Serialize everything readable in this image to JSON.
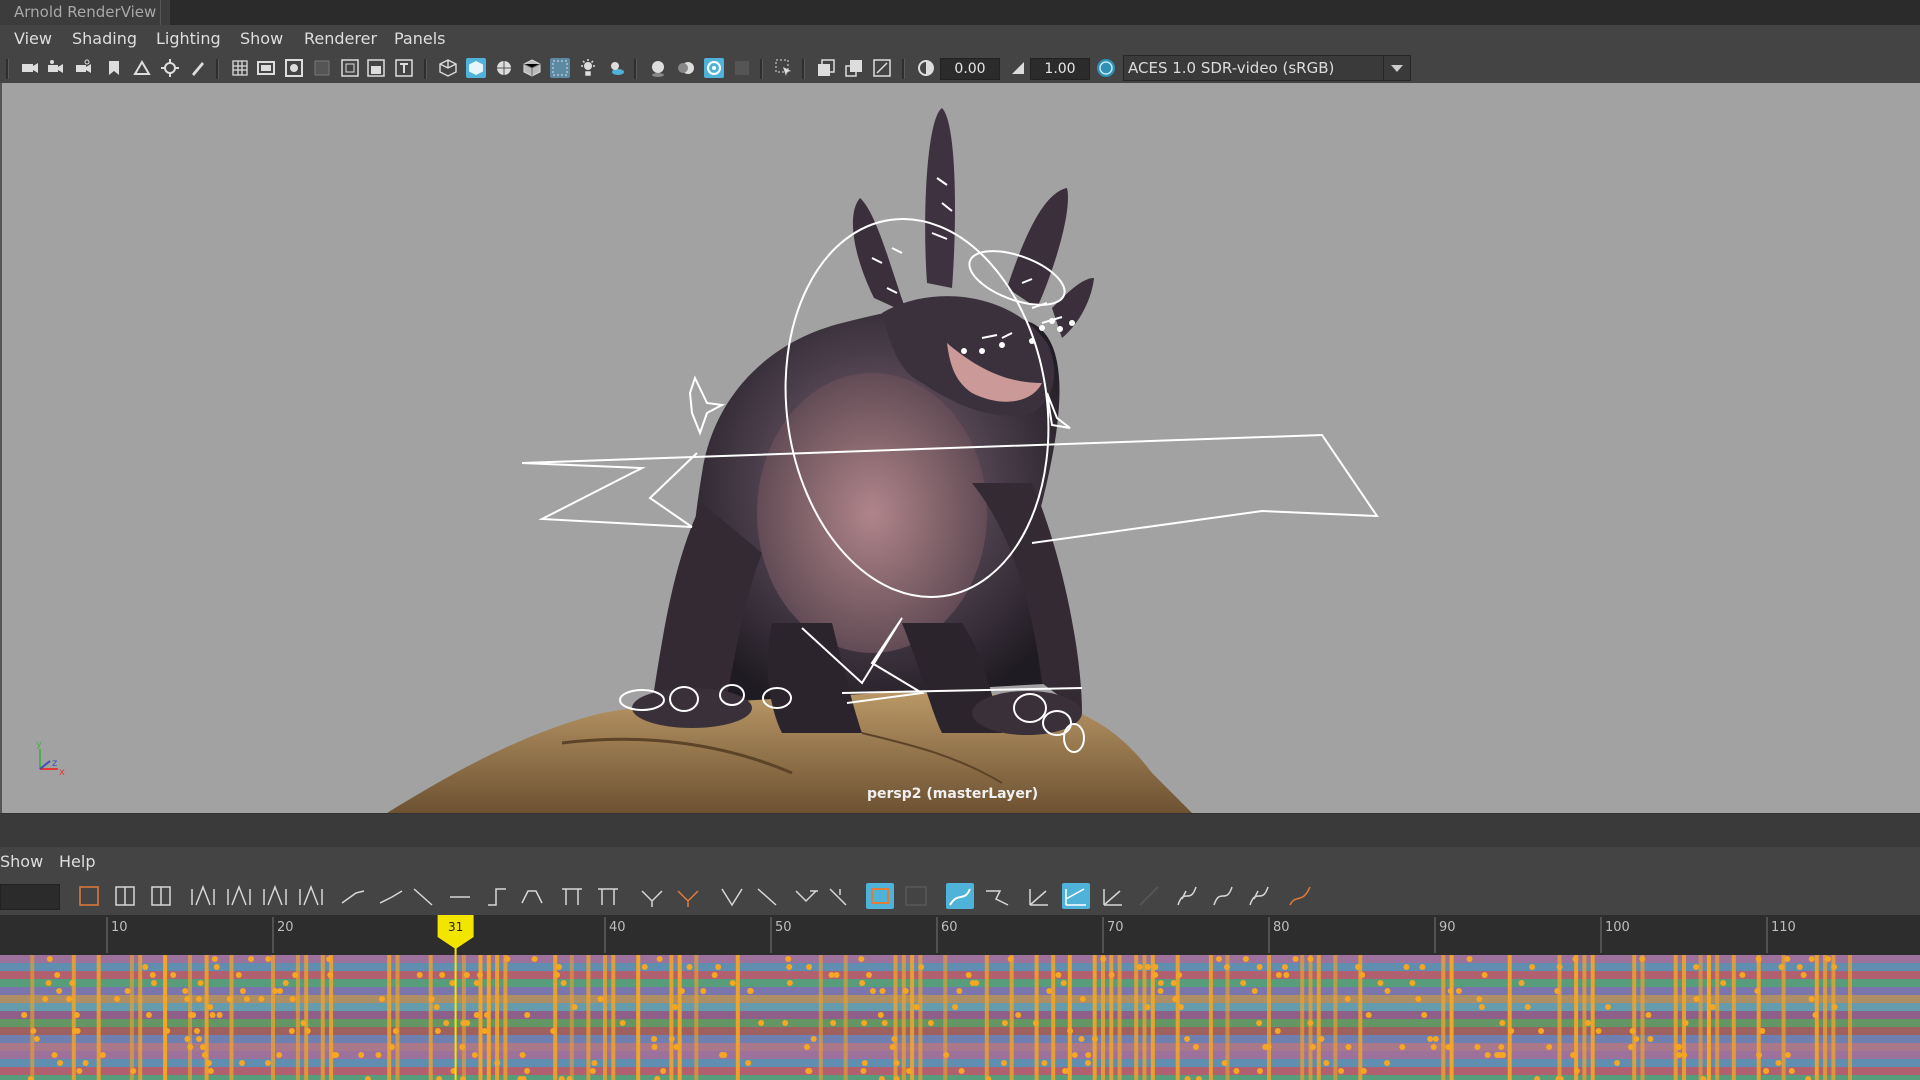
{
  "window": {
    "title": "Arnold RenderView"
  },
  "menu": {
    "items": [
      "View",
      "Shading",
      "Lighting",
      "Show",
      "Renderer",
      "Panels"
    ]
  },
  "toolbar": {
    "exposure_value": "0.00",
    "gamma_value": "1.00",
    "color_management": "ACES 1.0 SDR-video (sRGB)",
    "colors": {
      "active_icon": "#4fb3d9",
      "panel": "#444444"
    }
  },
  "viewport": {
    "camera_label": "persp2 (masterLayer)",
    "background": "#a2a2a2",
    "axis_labels": {
      "x": "x",
      "y": "y",
      "z": "z"
    }
  },
  "graph_editor": {
    "menu": [
      "Show",
      "Help"
    ],
    "current_frame": "31",
    "ruler_ticks": [
      "10",
      "20",
      "40",
      "50",
      "60",
      "70",
      "80",
      "90",
      "100",
      "110"
    ],
    "key_color": "#f5a623",
    "playhead_color": "#f2e600"
  }
}
